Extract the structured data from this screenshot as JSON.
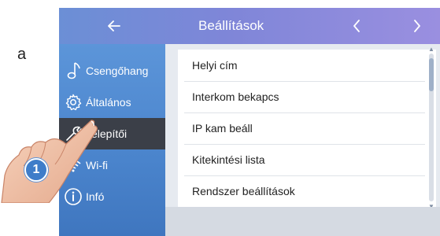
{
  "edge_text": "a",
  "topbar": {
    "back_icon": "arrow-left-icon",
    "title": "Beállítások",
    "prev_icon": "chevron-left-icon",
    "next_icon": "chevron-right-icon"
  },
  "sidebar": {
    "items": [
      {
        "label": "Csengőhang",
        "icon": "music-note-icon",
        "active": false
      },
      {
        "label": "Általános",
        "icon": "gear-icon",
        "active": false
      },
      {
        "label": "Telepítői",
        "icon": "wrench-icon",
        "active": true
      },
      {
        "label": "Wi-fi",
        "icon": "wifi-icon",
        "active": false
      },
      {
        "label": "Infó",
        "icon": "info-icon",
        "active": false
      }
    ]
  },
  "settings_list": [
    "Helyi cím",
    "Interkom bekapcs",
    "IP kam beáll",
    "Kitekintési lista",
    "Rendszer beállítások"
  ],
  "callout": {
    "number": "1"
  },
  "colors": {
    "topbar_start": "#6b8fd6",
    "topbar_end": "#9a8fe0",
    "sidebar": "#4a84cc",
    "sidebar_active": "#3b3f48",
    "callout": "#3f7dc9"
  }
}
